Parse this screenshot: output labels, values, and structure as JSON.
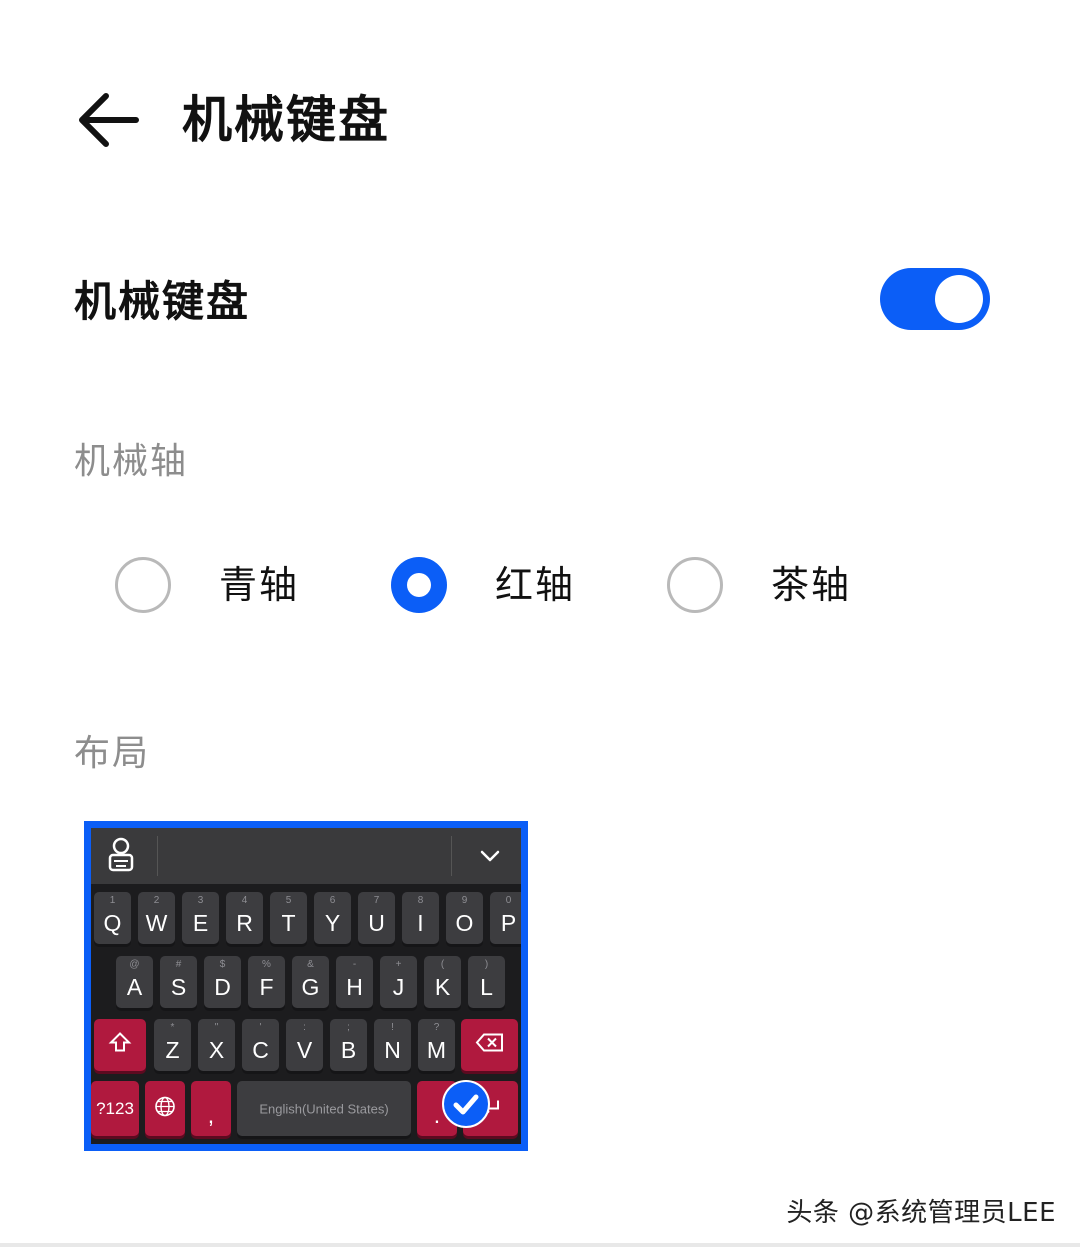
{
  "header": {
    "title": "机械键盘",
    "back_icon": "arrow-left-icon"
  },
  "toggle_row": {
    "label": "机械键盘",
    "enabled": true,
    "accent_color": "#0b5ef7"
  },
  "switch_section": {
    "title": "机械轴",
    "options": [
      {
        "label": "青轴",
        "selected": false
      },
      {
        "label": "红轴",
        "selected": true
      },
      {
        "label": "茶轴",
        "selected": false
      }
    ]
  },
  "layout_section": {
    "title": "布局",
    "preview": {
      "selected": true,
      "row1": [
        {
          "main": "Q",
          "sub": "1"
        },
        {
          "main": "W",
          "sub": "2"
        },
        {
          "main": "E",
          "sub": "3"
        },
        {
          "main": "R",
          "sub": "4"
        },
        {
          "main": "T",
          "sub": "5"
        },
        {
          "main": "Y",
          "sub": "6"
        },
        {
          "main": "U",
          "sub": "7"
        },
        {
          "main": "I",
          "sub": "8"
        },
        {
          "main": "O",
          "sub": "9"
        },
        {
          "main": "P",
          "sub": "0"
        }
      ],
      "row2": [
        {
          "main": "A",
          "sub": "@"
        },
        {
          "main": "S",
          "sub": "#"
        },
        {
          "main": "D",
          "sub": "$"
        },
        {
          "main": "F",
          "sub": "%"
        },
        {
          "main": "G",
          "sub": "&"
        },
        {
          "main": "H",
          "sub": "-"
        },
        {
          "main": "J",
          "sub": "+"
        },
        {
          "main": "K",
          "sub": "("
        },
        {
          "main": "L",
          "sub": ")"
        }
      ],
      "row3": [
        {
          "main": "Z",
          "sub": "*"
        },
        {
          "main": "X",
          "sub": "\""
        },
        {
          "main": "C",
          "sub": "'"
        },
        {
          "main": "V",
          "sub": ":"
        },
        {
          "main": "B",
          "sub": ";"
        },
        {
          "main": "N",
          "sub": "!"
        },
        {
          "main": "M",
          "sub": "?"
        }
      ],
      "row4": {
        "sym_label": "?123",
        "comma_label": ",",
        "space_label": "English(United States)",
        "period_label": "."
      }
    }
  },
  "watermark": "头条 @系统管理员LEE"
}
